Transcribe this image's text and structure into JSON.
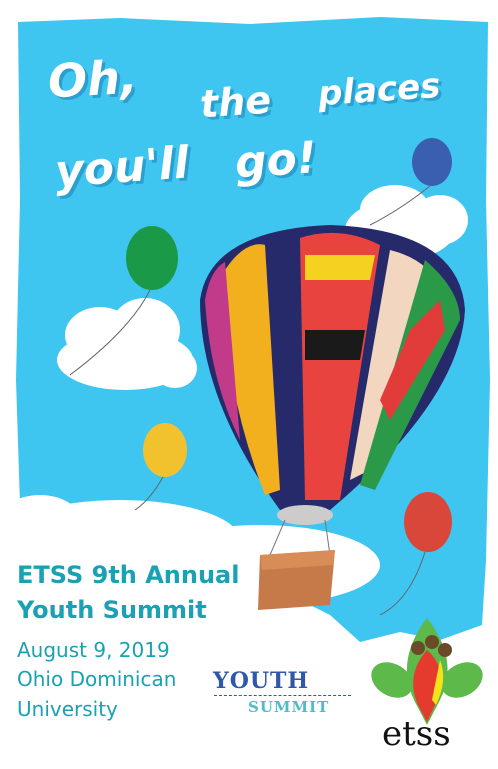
{
  "headline": {
    "line1_a": "Oh,",
    "line1_b": "the",
    "line1_c": "places",
    "line2_a": "you'll",
    "line2_b": "go!"
  },
  "event": {
    "title_line1": "ETSS 9th Annual",
    "title_line2": "Youth Summit",
    "date": "August 9, 2019",
    "venue_line1": "Ohio Dominican",
    "venue_line2": "University"
  },
  "logos": {
    "youth_summit_top": "YOUTH",
    "youth_summit_bottom": "SUMMIT",
    "etss": "etss"
  },
  "colors": {
    "sky": "#3ec6f0",
    "text_teal": "#1aa1b3",
    "balloon_green": "#1a9a48",
    "balloon_blue": "#3a5fb0",
    "balloon_yellow": "#f2c12e",
    "balloon_red": "#d9473a"
  }
}
